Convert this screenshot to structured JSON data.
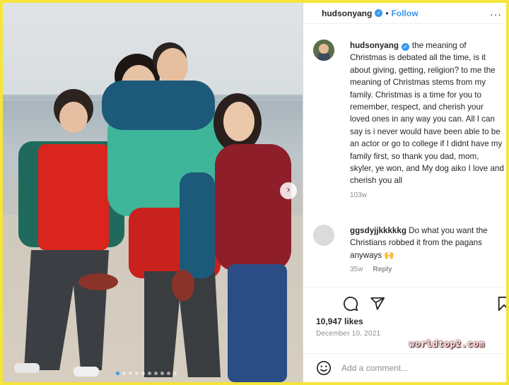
{
  "post": {
    "username": "hudsonyang",
    "follow_label": "Follow",
    "separator": "•",
    "more_label": "···"
  },
  "caption": {
    "username": "hudsonyang",
    "text": "the meaning of Christmas is debated all the time, is it about giving, getting, religion? to me the meaning of Christmas stems from my family. Christmas is a time for you to remember, respect, and cherish your loved ones in any way you can. All I can say is i never would have been able to be an actor or go to college if I didnt have my family first, so thank you dad, mom, skyler, ye won, and My dog aiko I love and cherish you all",
    "age": "103w"
  },
  "comment": {
    "username": "ggsdyjjkkkkkg",
    "text": "Do what you want the Christians robbed it from the pagans anyways 🙌",
    "age": "35w",
    "reply_label": "Reply"
  },
  "stats": {
    "likes": "10,947 likes",
    "date": "December 10, 2021"
  },
  "watermark": "worldtop2.com",
  "add_comment": {
    "placeholder": "Add a comment..."
  },
  "carousel": {
    "slide_count": 10,
    "active_index": 0
  },
  "icons": [
    "verified-badge-icon",
    "more-icon",
    "next-arrow-icon",
    "comment-icon",
    "share-icon",
    "save-icon",
    "emoji-icon"
  ],
  "colors": {
    "frame_border": "#f5e43a",
    "accent": "#3897f0"
  }
}
